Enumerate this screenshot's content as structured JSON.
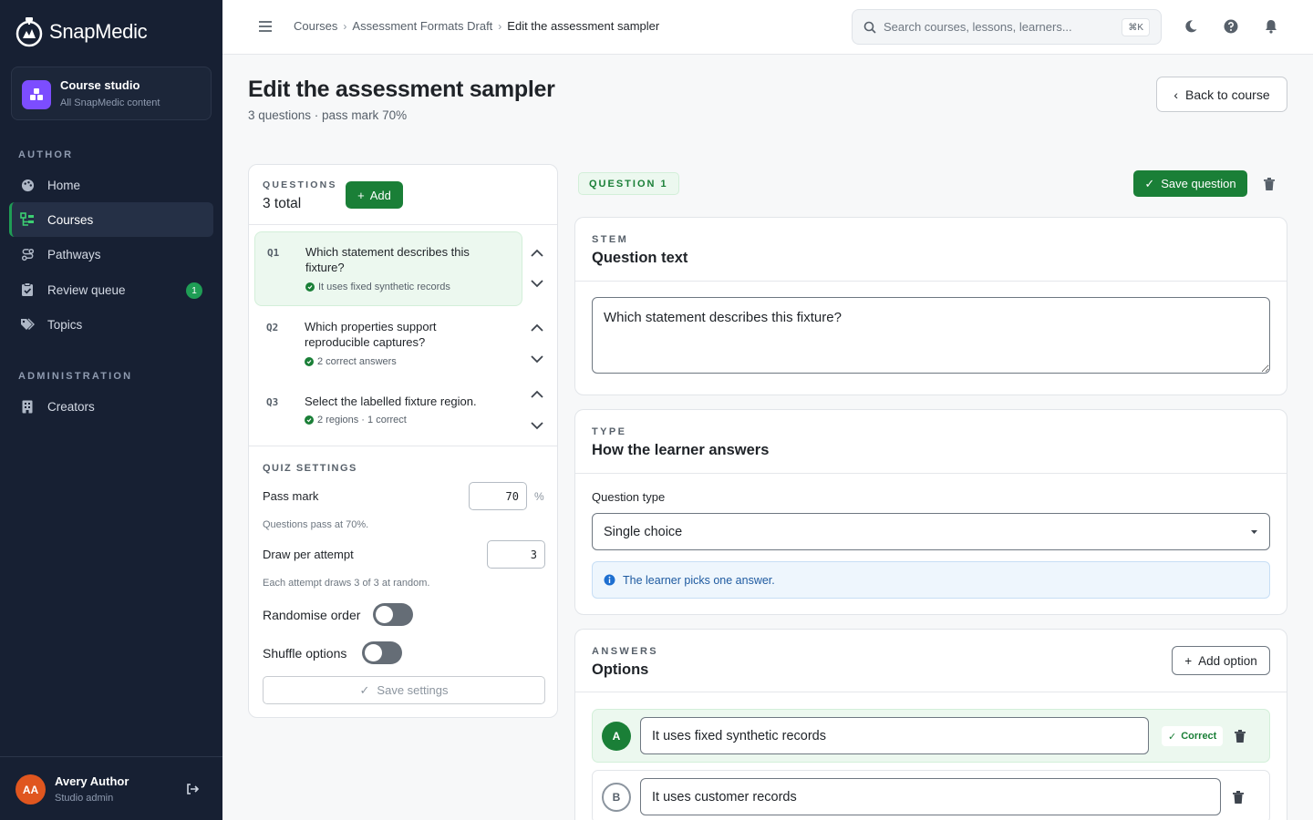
{
  "app": {
    "name": "SnapMedic"
  },
  "studio": {
    "title": "Course studio",
    "subtitle": "All SnapMedic content"
  },
  "sidebar": {
    "author_label": "AUTHOR",
    "admin_label": "ADMINISTRATION",
    "items": [
      {
        "label": "Home",
        "icon": "palette-icon"
      },
      {
        "label": "Courses",
        "icon": "sitemap-icon",
        "active": true
      },
      {
        "label": "Pathways",
        "icon": "route-icon"
      },
      {
        "label": "Review queue",
        "icon": "clipboard-check-icon",
        "badge": "1"
      },
      {
        "label": "Topics",
        "icon": "tags-icon"
      }
    ],
    "admin_items": [
      {
        "label": "Creators",
        "icon": "building-icon"
      }
    ]
  },
  "user": {
    "initials": "AA",
    "name": "Avery Author",
    "role": "Studio admin"
  },
  "breadcrumb": {
    "items": [
      "Courses",
      "Assessment Formats Draft"
    ],
    "current": "Edit the assessment sampler"
  },
  "search": {
    "placeholder": "Search courses, lessons, learners...",
    "shortcut": "⌘K"
  },
  "header": {
    "title": "Edit the assessment sampler",
    "subtitle": "3 questions · pass mark 70%",
    "back_label": "Back to course"
  },
  "questions": {
    "label": "QUESTIONS",
    "total": "3 total",
    "add_label": "Add",
    "items": [
      {
        "num": "Q1",
        "text": "Which statement describes this fixture?",
        "meta": "It uses fixed synthetic records",
        "active": true
      },
      {
        "num": "Q2",
        "text": "Which properties support reproducible captures?",
        "meta": "2 correct answers"
      },
      {
        "num": "Q3",
        "text": "Select the labelled fixture region.",
        "meta": "2 regions · 1 correct"
      }
    ]
  },
  "quiz_settings": {
    "label": "QUIZ SETTINGS",
    "pass_mark_label": "Pass mark",
    "pass_mark_value": "70",
    "pass_mark_unit": "%",
    "pass_hint": "Questions pass at 70%.",
    "draw_label": "Draw per attempt",
    "draw_value": "3",
    "draw_hint": "Each attempt draws 3 of 3 at random.",
    "randomise_label": "Randomise order",
    "randomise_on": false,
    "shuffle_label": "Shuffle options",
    "shuffle_on": false,
    "save_label": "Save settings"
  },
  "editor": {
    "badge": "QUESTION 1",
    "save_label": "Save question",
    "stem": {
      "eyebrow": "STEM",
      "title": "Question text",
      "value": "Which statement describes this fixture?"
    },
    "type": {
      "eyebrow": "TYPE",
      "title": "How the learner answers",
      "field_label": "Question type",
      "selected": "Single choice",
      "info": "The learner picks one answer."
    },
    "answers": {
      "eyebrow": "ANSWERS",
      "title": "Options",
      "add_label": "Add option",
      "options": [
        {
          "letter": "A",
          "text": "It uses fixed synthetic records",
          "correct": true,
          "correct_label": "Correct"
        },
        {
          "letter": "B",
          "text": "It uses customer records",
          "correct": false
        }
      ]
    }
  },
  "colors": {
    "sidebar": "#172033",
    "accent": "#1a7f37",
    "brand_purple": "#7c4dff",
    "avatar": "#e0561f"
  }
}
